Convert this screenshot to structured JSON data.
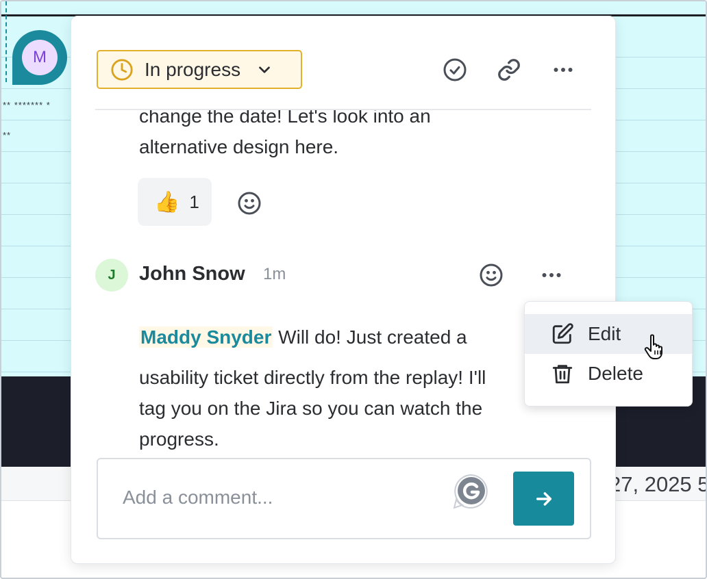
{
  "background": {
    "date_text": "27, 2025 5",
    "stars_row_1": "** ******* *",
    "stars_row_2": "**",
    "avatar_initial": "M"
  },
  "popover": {
    "status": {
      "label": "In progress",
      "icon": "clock-icon",
      "color": "#e2b02a"
    },
    "header_actions": [
      {
        "name": "resolve",
        "icon": "check-circle-icon"
      },
      {
        "name": "copy-link",
        "icon": "link-icon"
      },
      {
        "name": "more",
        "icon": "more-horizontal-icon"
      }
    ],
    "previous_message": {
      "text": "change the date! Let's look into an alternative design here.",
      "reaction": {
        "emoji": "👍",
        "count": "1"
      }
    },
    "message": {
      "author_initial": "J",
      "author_name": "John Snow",
      "time": "1m",
      "mention": "Maddy Snyder",
      "line_1": "Will do! Just created a",
      "line_2": "usability ticket directly from the replay! I'll",
      "line_3": "tag you on the Jira so you can watch the",
      "line_4": "progress."
    },
    "comment": {
      "placeholder": "Add a comment...",
      "send_icon": "arrow-right-icon"
    }
  },
  "context_menu": {
    "items": [
      {
        "label": "Edit",
        "icon": "edit-icon"
      },
      {
        "label": "Delete",
        "icon": "trash-icon"
      }
    ]
  },
  "colors": {
    "accent": "#178a9c",
    "status_border": "#e2b02a",
    "mention": "#1b8a9d",
    "background_cyan": "#d7fbfd"
  }
}
